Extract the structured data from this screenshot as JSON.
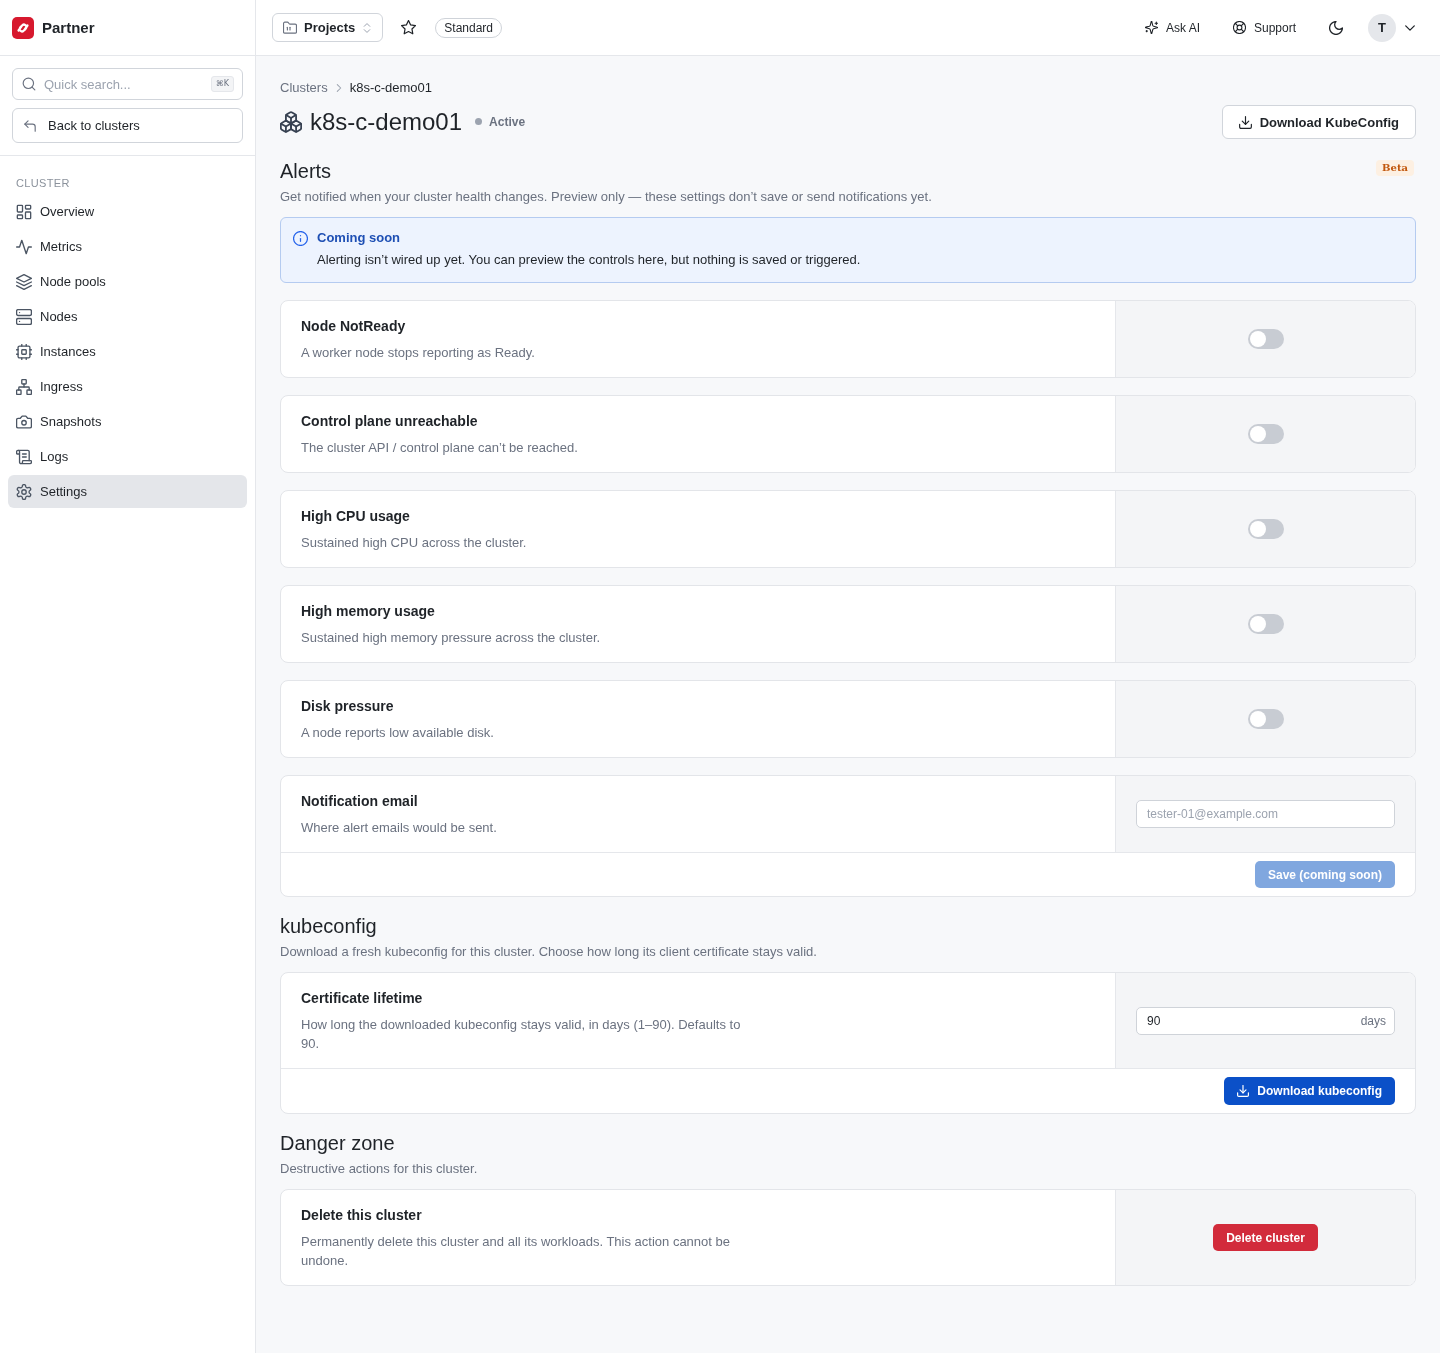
{
  "sidebar": {
    "brand": "Partner",
    "search": {
      "placeholder": "Quick search...",
      "shortcut": "⌘K"
    },
    "back_button": "Back to clusters",
    "section_label": "CLUSTER",
    "items": [
      {
        "label": "Overview",
        "selected": false
      },
      {
        "label": "Metrics",
        "selected": false
      },
      {
        "label": "Node pools",
        "selected": false
      },
      {
        "label": "Nodes",
        "selected": false
      },
      {
        "label": "Instances",
        "selected": false
      },
      {
        "label": "Ingress",
        "selected": false
      },
      {
        "label": "Snapshots",
        "selected": false
      },
      {
        "label": "Logs",
        "selected": false
      },
      {
        "label": "Settings",
        "selected": true
      }
    ]
  },
  "topbar": {
    "project_switcher": "Projects",
    "plan": "Standard",
    "actions": [
      "Ask AI",
      "Support"
    ],
    "avatar": "T"
  },
  "header": {
    "breadcrumb": [
      "Clusters",
      "k8s-c-demo01"
    ],
    "title": "k8s-c-demo01",
    "status": "Active",
    "download_button": "Download KubeConfig"
  },
  "alerts": {
    "title": "Alerts",
    "badge": "Beta",
    "description": "Get notified when your cluster health changes. Preview only — these settings don’t save or send notifications yet.",
    "notice": {
      "title": "Coming soon",
      "text": "Alerting isn’t wired up yet. You can preview the controls here, but nothing is saved or triggered."
    },
    "rules": [
      {
        "title": "Node NotReady",
        "description": "A worker node stops reporting as Ready.",
        "on": false
      },
      {
        "title": "Control plane unreachable",
        "description": "The cluster API / control plane can’t be reached.",
        "on": false
      },
      {
        "title": "High CPU usage",
        "description": "Sustained high CPU across the cluster.",
        "on": false
      },
      {
        "title": "High memory usage",
        "description": "Sustained high memory pressure across the cluster.",
        "on": false
      },
      {
        "title": "Disk pressure",
        "description": "A node reports low available disk.",
        "on": false
      }
    ],
    "email": {
      "title": "Notification email",
      "description": "Where alert emails would be sent.",
      "placeholder": "tester-01@example.com",
      "button": "Save (coming soon)",
      "disabled": true
    }
  },
  "kubeconfig": {
    "title": "kubeconfig",
    "description": "Download a fresh kubeconfig for this cluster. Choose how long its client certificate stays valid.",
    "lifetime": {
      "title": "Certificate lifetime",
      "description": "How long the downloaded kubeconfig stays valid, in days (1–90). Defaults to 90.",
      "value": "90",
      "unit": "days"
    },
    "button": "Download kubeconfig"
  },
  "danger_zone": {
    "title": "Danger zone",
    "description": "Destructive actions for this cluster.",
    "action": {
      "title": "Delete this cluster",
      "description": "Permanently delete this cluster and all its workloads. This action cannot be undone.",
      "button": "Delete cluster"
    }
  }
}
